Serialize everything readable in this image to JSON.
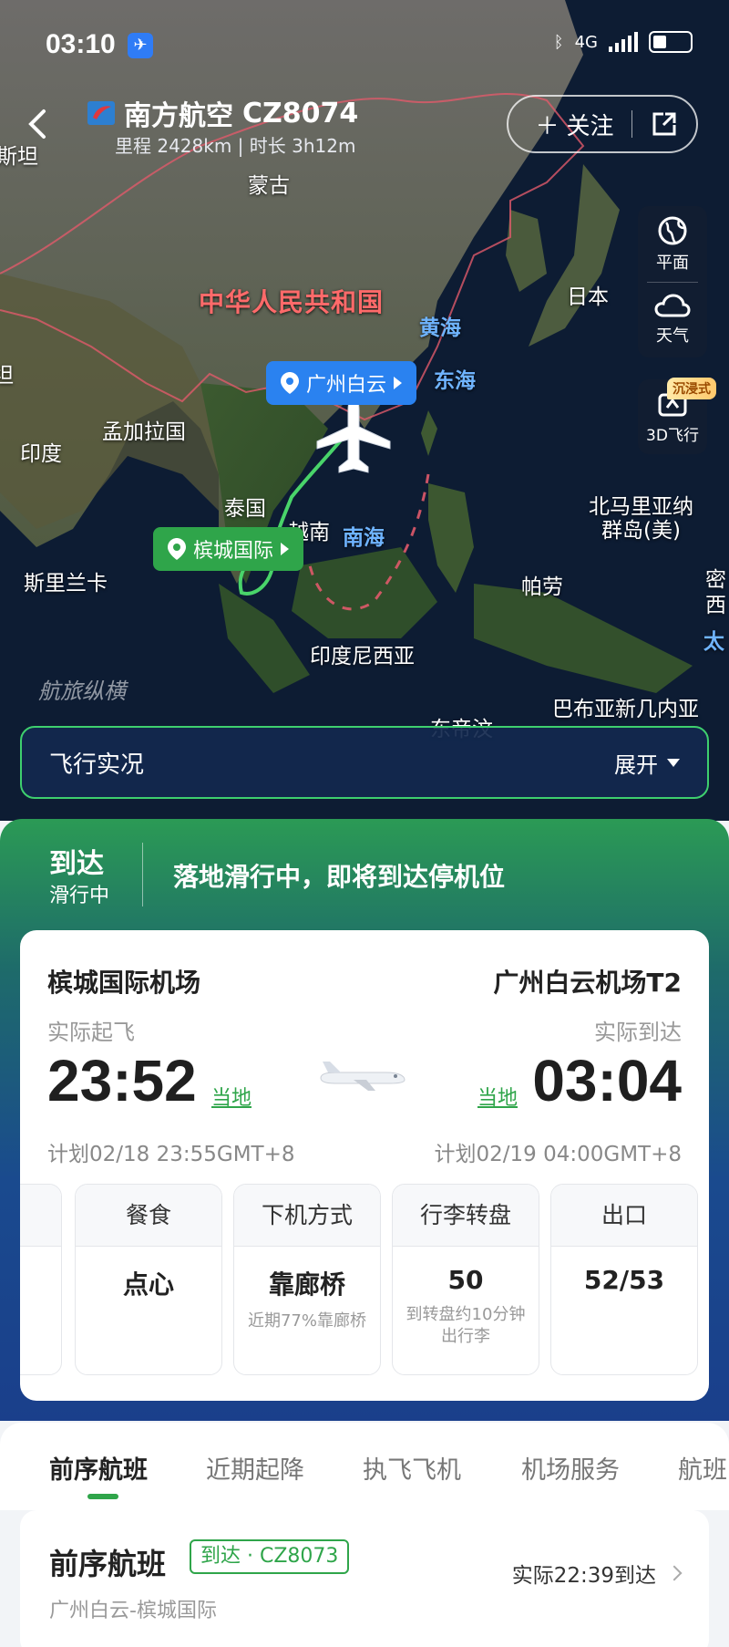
{
  "status_bar": {
    "time": "03:10",
    "network": "4G"
  },
  "header": {
    "airline": "南方航空",
    "flight_no": "CZ8074",
    "subtitle": "里程 2428km | 时长 3h12m",
    "follow_label": "关注"
  },
  "map": {
    "labels": {
      "mongolia": "蒙古",
      "china": "中华人民共和国",
      "yellow_sea": "黄海",
      "east_sea": "东海",
      "japan": "日本",
      "india": "印度",
      "bangladesh": "孟加拉国",
      "thailand": "泰国",
      "vietnam": "越南",
      "south_sea": "南海",
      "sri_lanka": "斯里兰卡",
      "palau": "帕劳",
      "nmi_1": "北马里亚纳",
      "nmi_2": "群岛(美)",
      "indonesia": "印度尼西亚",
      "png": "巴布亚新几内亚",
      "timor": "东帝汶",
      "left_edge_1": "斯坦",
      "left_edge_2": "坦",
      "right_edge_1": "密",
      "right_edge_2": "西",
      "right_edge_3": "太"
    },
    "origin_pin": "槟城国际",
    "dest_pin": "广州白云",
    "watermark": "航旅纵横"
  },
  "tools": {
    "flat_label": "平面",
    "weather_label": "天气",
    "flight3d_label": "3D飞行",
    "immersive_badge": "沉浸式"
  },
  "live_bar": {
    "title": "飞行实况",
    "expand_label": "展开"
  },
  "status": {
    "state": "到达",
    "substate": "滑行中",
    "message": "落地滑行中，即将到达停机位"
  },
  "departure": {
    "airport": "槟城国际机场",
    "label": "实际起飞",
    "time": "23:52",
    "local": "当地",
    "planned": "计划02/18 23:55GMT+8"
  },
  "arrival": {
    "airport": "广州白云机场T2",
    "label": "实际到达",
    "time": "03:04",
    "local": "当地",
    "planned": "计划02/19 04:00GMT+8"
  },
  "info_cells": [
    {
      "header": "餐食",
      "value": "点心",
      "note": ""
    },
    {
      "header": "下机方式",
      "value": "靠廊桥",
      "note": "近期77%靠廊桥"
    },
    {
      "header": "行李转盘",
      "value": "50",
      "note": "到转盘约10分钟出行李"
    },
    {
      "header": "出口",
      "value": "52/53",
      "note": ""
    }
  ],
  "tabs": [
    "前序航班",
    "近期起降",
    "执飞飞机",
    "机场服务",
    "航班"
  ],
  "prev_flight": {
    "title": "前序航班",
    "tag": "到达 · CZ8073",
    "route": "广州白云-槟城国际",
    "time": "实际22:39到达"
  },
  "colors": {
    "accent_green": "#2fa54a",
    "pin_blue": "#2a82f0",
    "status_blue": "#1a3f8b"
  }
}
